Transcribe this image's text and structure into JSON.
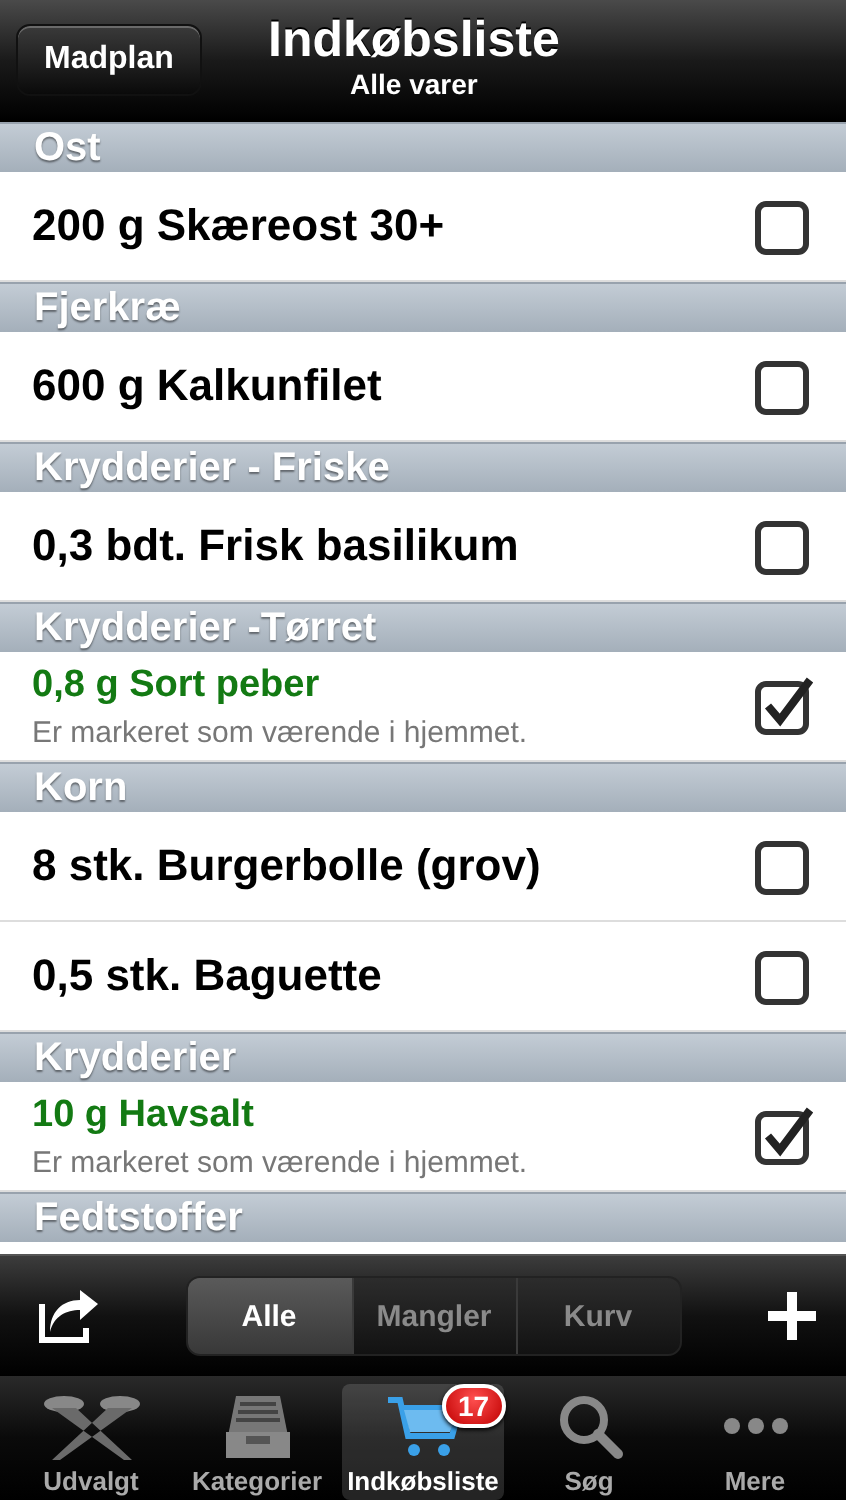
{
  "nav": {
    "back_button": "Madplan",
    "title": "Indkøbsliste",
    "subtitle": "Alle varer"
  },
  "sections": [
    {
      "header": "Ost",
      "items": [
        {
          "name": "200 g Skæreost 30+",
          "checked": false
        }
      ]
    },
    {
      "header": "Fjerkræ",
      "items": [
        {
          "name": "600 g Kalkunfilet",
          "checked": false
        }
      ]
    },
    {
      "header": "Krydderier - Friske",
      "items": [
        {
          "name": "0,3 bdt. Frisk basilikum",
          "checked": false
        }
      ]
    },
    {
      "header": "Krydderier -Tørret",
      "items": [
        {
          "name": "0,8 g Sort peber",
          "checked": true,
          "note": "Er markeret som værende i hjemmet."
        }
      ]
    },
    {
      "header": "Korn",
      "items": [
        {
          "name": "8 stk. Burgerbolle (grov)",
          "checked": false
        },
        {
          "name": "0,5 stk. Baguette",
          "checked": false
        }
      ]
    },
    {
      "header": "Krydderier",
      "items": [
        {
          "name": "10 g Havsalt",
          "checked": true,
          "note": "Er markeret som værende i hjemmet."
        }
      ]
    },
    {
      "header": "Fedtstoffer"
    }
  ],
  "toolbar": {
    "segments": [
      {
        "label": "Alle",
        "selected": true
      },
      {
        "label": "Mangler",
        "selected": false
      },
      {
        "label": "Kurv",
        "selected": false
      }
    ]
  },
  "tab_bar": [
    {
      "kind": "spotlight",
      "label": "Udvalgt",
      "selected": false
    },
    {
      "kind": "drawer",
      "label": "Kategorier",
      "selected": false
    },
    {
      "kind": "cart",
      "label": "Indkøbsliste",
      "selected": true,
      "badge": "17"
    },
    {
      "kind": "search",
      "label": "Søg",
      "selected": false
    },
    {
      "kind": "more",
      "label": "Mere",
      "selected": false
    }
  ]
}
